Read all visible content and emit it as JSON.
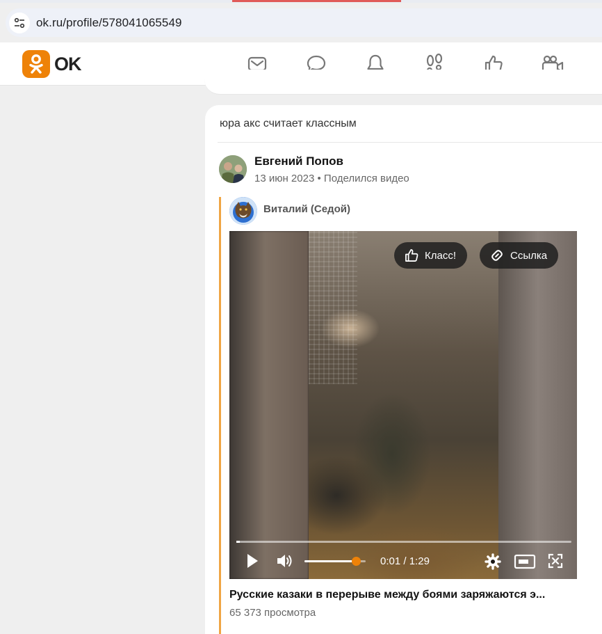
{
  "browser": {
    "url": "ok.ru/profile/578041065549",
    "site_icon": "tune-icon"
  },
  "header": {
    "logo_text": "OK",
    "brand_color": "#ee8208",
    "nav_icons": [
      "mail-icon",
      "chat-icon",
      "bell-icon",
      "footprints-icon",
      "like-icon",
      "video-camera-icon"
    ]
  },
  "post": {
    "header_text": "юра акс считает классным",
    "author": {
      "name": "Евгений Попов",
      "date": "13 июн 2023",
      "separator": "•",
      "action": "Поделился видео"
    },
    "original": {
      "author_name": "Виталий (Седой)",
      "accent_color": "#f0a544"
    },
    "video": {
      "like_label": "Класс!",
      "link_label": "Ссылка",
      "time_current": "0:01",
      "time_total": "1:29",
      "time_separator": "/",
      "progress": 0.01,
      "volume": 0.85,
      "title": "Русские казаки в перерыве между боями заряжаются э...",
      "views": "65 373 просмотра"
    }
  }
}
